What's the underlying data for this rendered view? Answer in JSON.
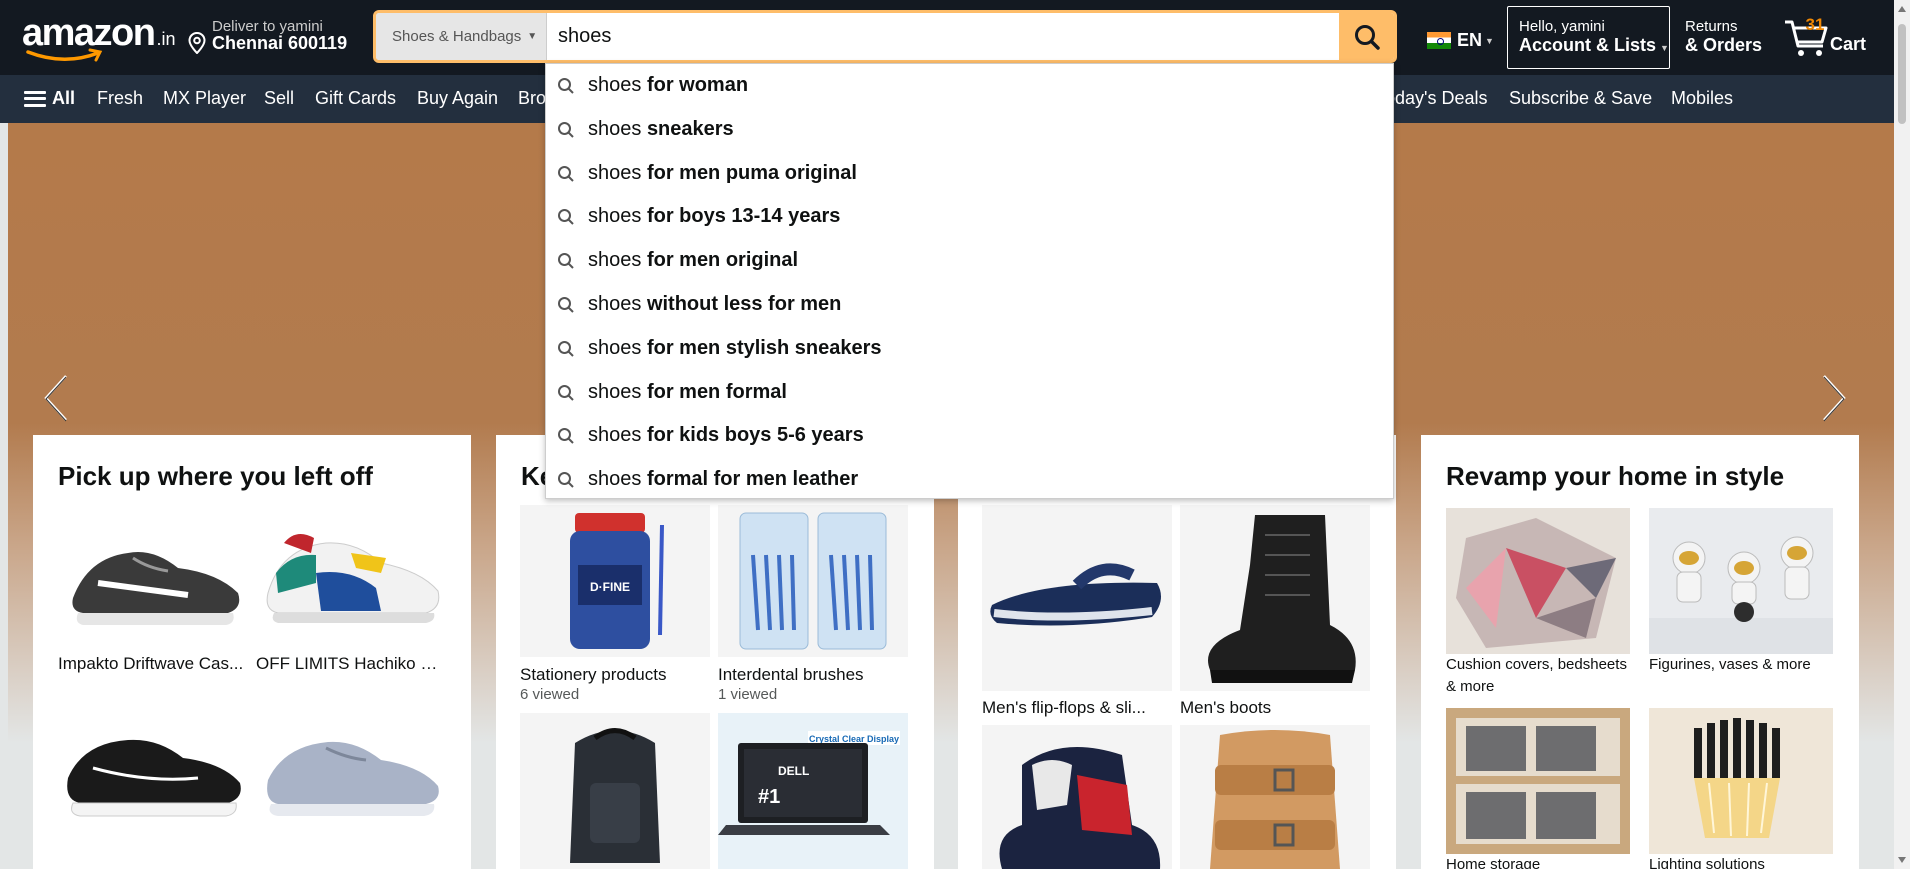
{
  "header": {
    "logo_text": "amazon",
    "logo_tld": ".in",
    "deliver_line1": "Deliver to yamini",
    "deliver_line2": "Chennai 600119",
    "search_category": "Shoes & Handbags",
    "search_value": "shoes",
    "language": "EN",
    "account_line1": "Hello, yamini",
    "account_line2": "Account & Lists",
    "returns_line1": "Returns",
    "returns_line2": "& Orders",
    "cart_count": "31",
    "cart_label": "Cart"
  },
  "nav": {
    "all": "All",
    "items": [
      "Fresh",
      "MX Player",
      "Sell",
      "Gift Cards",
      "Buy Again",
      "Bro",
      "oday's Deals",
      "Subscribe & Save",
      "Mobiles"
    ]
  },
  "suggestions": [
    {
      "prefix": "shoes ",
      "suffix": "for woman"
    },
    {
      "prefix": "shoes ",
      "suffix": "sneakers"
    },
    {
      "prefix": "shoes ",
      "suffix": "for men puma original"
    },
    {
      "prefix": "shoes ",
      "suffix": "for boys 13-14 years"
    },
    {
      "prefix": "shoes ",
      "suffix": "for men original"
    },
    {
      "prefix": "shoes ",
      "suffix": "without less for men"
    },
    {
      "prefix": "shoes ",
      "suffix": "for men stylish sneakers"
    },
    {
      "prefix": "shoes ",
      "suffix": "for men formal"
    },
    {
      "prefix": "shoes ",
      "suffix": "for kids boys 5-6 years"
    },
    {
      "prefix": "shoes ",
      "suffix": "formal for men leather"
    }
  ],
  "cards": {
    "pickup": {
      "title": "Pick up where you left off",
      "items": [
        "Impakto Driftwave Cas...",
        "OFF LIMITS Hachiko Me..."
      ]
    },
    "keep": {
      "title_fragment": "Ke",
      "items": [
        {
          "label": "Stationery products",
          "sub": "6 viewed"
        },
        {
          "label": "Interdental brushes",
          "sub": "1 viewed"
        }
      ]
    },
    "mens": {
      "items": [
        "Men's flip-flops & sli...",
        "Men's boots"
      ]
    },
    "home": {
      "title": "Revamp your home in style",
      "items": [
        "Cushion covers, bedsheets & more",
        "Figurines, vases & more",
        "Home storage",
        "Lighting solutions"
      ]
    }
  },
  "colors": {
    "header_bg": "#131921",
    "nav_bg": "#232f3e",
    "search_accent": "#febd69",
    "cart_count": "#f08804",
    "hero_bg": "#b47a4a"
  }
}
